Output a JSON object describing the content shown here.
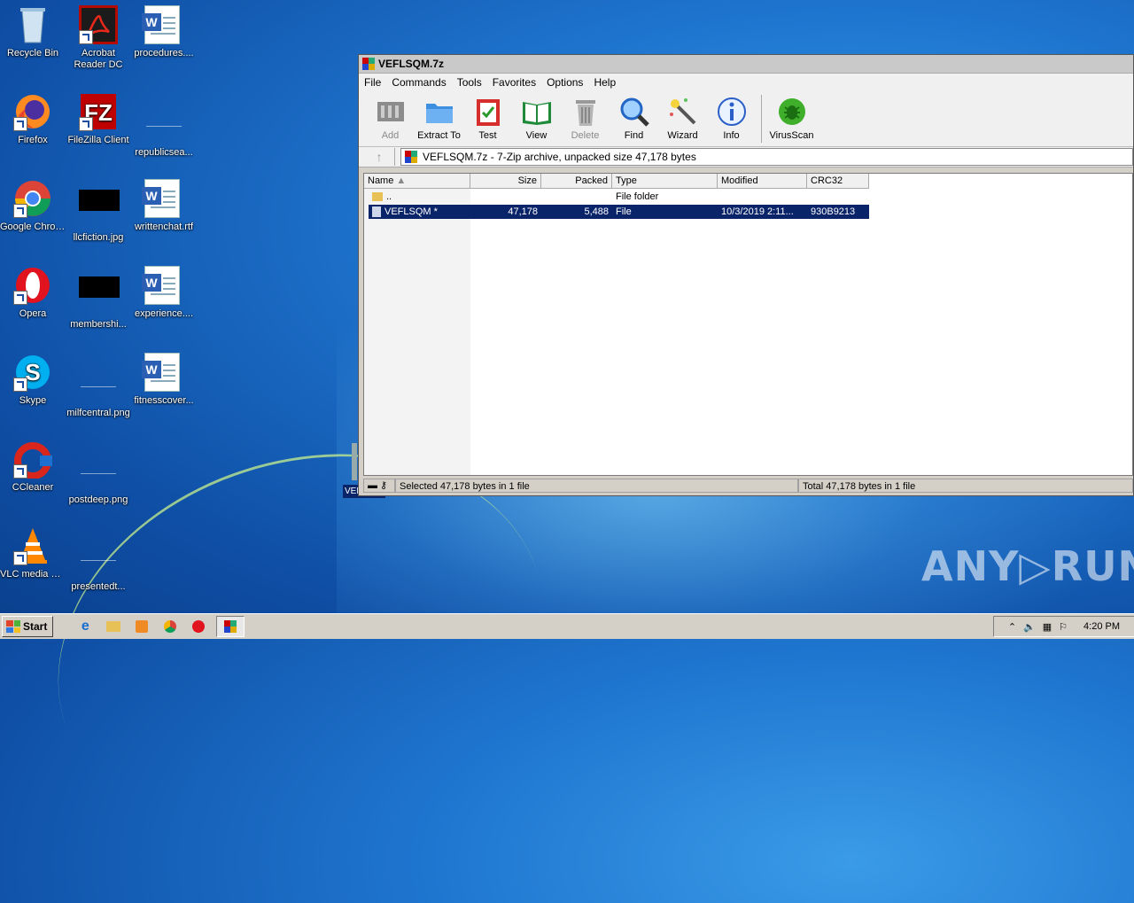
{
  "desktop": {
    "icons": [
      {
        "label": "Recycle Bin"
      },
      {
        "label": "Acrobat Reader DC"
      },
      {
        "label": "procedures...."
      },
      {
        "label": "Firefox"
      },
      {
        "label": "FileZilla Client"
      },
      {
        "label": "republicsea..."
      },
      {
        "label": "Google Chrome"
      },
      {
        "label": "llcfiction.jpg"
      },
      {
        "label": "writtenchat.rtf"
      },
      {
        "label": "Opera"
      },
      {
        "label": "membershi..."
      },
      {
        "label": "experience...."
      },
      {
        "label": "Skype"
      },
      {
        "label": "milfcentral.png"
      },
      {
        "label": "fitnesscover..."
      },
      {
        "label": "CCleaner"
      },
      {
        "label": "postdeep.png"
      },
      {
        "label": "VLC media player"
      },
      {
        "label": "presentedt..."
      }
    ],
    "ghost_label": "VEFL",
    "watermark": "ANY▷RUN"
  },
  "window": {
    "title": "VEFLSQM.7z",
    "menu": [
      "File",
      "Commands",
      "Tools",
      "Favorites",
      "Options",
      "Help"
    ],
    "toolbar": [
      "Add",
      "Extract To",
      "Test",
      "View",
      "Delete",
      "Find",
      "Wizard",
      "Info",
      "VirusScan"
    ],
    "address": "VEFLSQM.7z - 7-Zip archive, unpacked size 47,178 bytes",
    "columns": [
      "Name",
      "Size",
      "Packed",
      "Type",
      "Modified",
      "CRC32"
    ],
    "rows": [
      {
        "name": "..",
        "size": "",
        "packed": "",
        "type": "File folder",
        "modified": "",
        "crc": ""
      },
      {
        "name": "VEFLSQM *",
        "size": "47,178",
        "packed": "5,488",
        "type": "File",
        "modified": "10/3/2019 2:11...",
        "crc": "930B9213"
      }
    ],
    "status_left": "Selected 47,178 bytes in 1 file",
    "status_right": "Total 47,178 bytes in 1 file"
  },
  "taskbar": {
    "start": "Start",
    "clock": "4:20 PM"
  }
}
